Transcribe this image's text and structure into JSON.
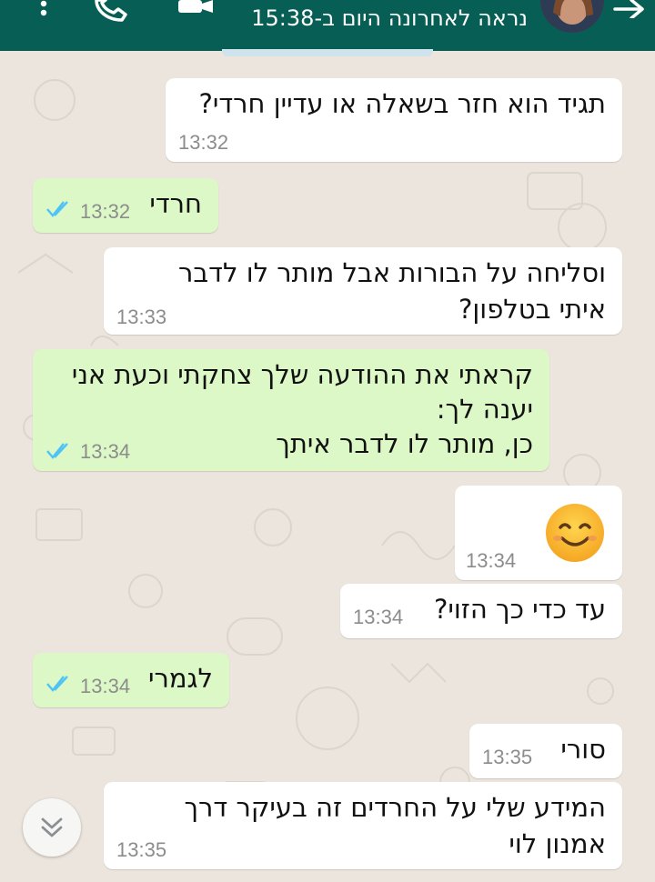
{
  "header": {
    "status": "נראה לאחרונה היום ב-15:38",
    "icons": [
      "more-vertical-icon",
      "phone-call-icon",
      "video-call-icon",
      "back-arrow-icon"
    ]
  },
  "messages": [
    {
      "direction": "in",
      "text": [
        "תגיד הוא חזר בשאלה או עדיין חרדי?"
      ],
      "time": "13:32"
    },
    {
      "direction": "out",
      "text": [
        "חרדי"
      ],
      "time": "13:32",
      "status": "read"
    },
    {
      "direction": "in",
      "text": [
        "וסליחה על הבורות אבל מותר לו לדבר",
        "איתי בטלפון?"
      ],
      "time": "13:33"
    },
    {
      "direction": "out",
      "text": [
        "קראתי את ההודעה שלך צחקתי וכעת אני",
        "יענה לך:",
        "כן, מותר לו לדבר איתך"
      ],
      "time": "13:34",
      "status": "read"
    },
    {
      "direction": "in",
      "emoji": "smiling-face-emoji",
      "time": "13:34"
    },
    {
      "direction": "in",
      "text": [
        "עד כדי כך הזוי?"
      ],
      "time": "13:34"
    },
    {
      "direction": "out",
      "text": [
        "לגמרי"
      ],
      "time": "13:34",
      "status": "read"
    },
    {
      "direction": "in",
      "text": [
        "סורי"
      ],
      "time": "13:35"
    },
    {
      "direction": "in",
      "text": [
        "המידע שלי על החרדים זה בעיקר דרך",
        "אמנון לוי"
      ],
      "time": "13:35"
    }
  ],
  "colors": {
    "header": "#075e54",
    "wallpaper": "#ece5dd",
    "incoming_bubble": "#ffffff",
    "outgoing_bubble": "#dcf8c6",
    "read_ticks": "#4fc3f7"
  },
  "scroll_button_icon": "double-chevron-down-icon"
}
